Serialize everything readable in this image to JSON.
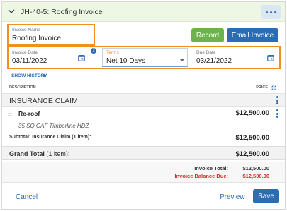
{
  "header": {
    "title": "JH-40-5: Roofing Invoice"
  },
  "invoice_name": {
    "label": "Invoice Name",
    "value": "Roofing Invoice"
  },
  "actions": {
    "record": "Record",
    "email_invoice": "Email Invoice"
  },
  "invoice_date": {
    "label": "Invoice Date",
    "value": "03/11/2022",
    "help": "?"
  },
  "terms": {
    "label": "Terms",
    "value": "Net 10 Days"
  },
  "due_date": {
    "label": "Due Date",
    "value": "03/21/2022"
  },
  "show_history": "SHOW HISTORY",
  "table": {
    "description_header": "DESCRIPTION",
    "price_header": "PRICE"
  },
  "section": {
    "name": "INSURANCE CLAIM"
  },
  "item": {
    "name": "Re-roof",
    "detail": "35 SQ GAF Timberline HDZ",
    "price": "$12,500.00"
  },
  "subtotal": {
    "label": "Subtotal: Insurance Claim (1 item):",
    "value": "$12,500.00"
  },
  "grand_total": {
    "label": "Grand Total",
    "count": "(1 item):",
    "value": "$12,500.00"
  },
  "invoice_total": {
    "label": "Invoice Total:",
    "value": "$12,500.00"
  },
  "balance_due": {
    "label": "Invoice Balance Due:",
    "value": "$12,500.00"
  },
  "footer": {
    "cancel": "Cancel",
    "preview": "Preview",
    "save": "Save"
  },
  "colors": {
    "accent_blue": "#2b6cb3",
    "record_green": "#6bb34a",
    "balance_red": "#d12c2c",
    "highlight_orange": "#f0901e",
    "header_green": "#eef7e3"
  }
}
